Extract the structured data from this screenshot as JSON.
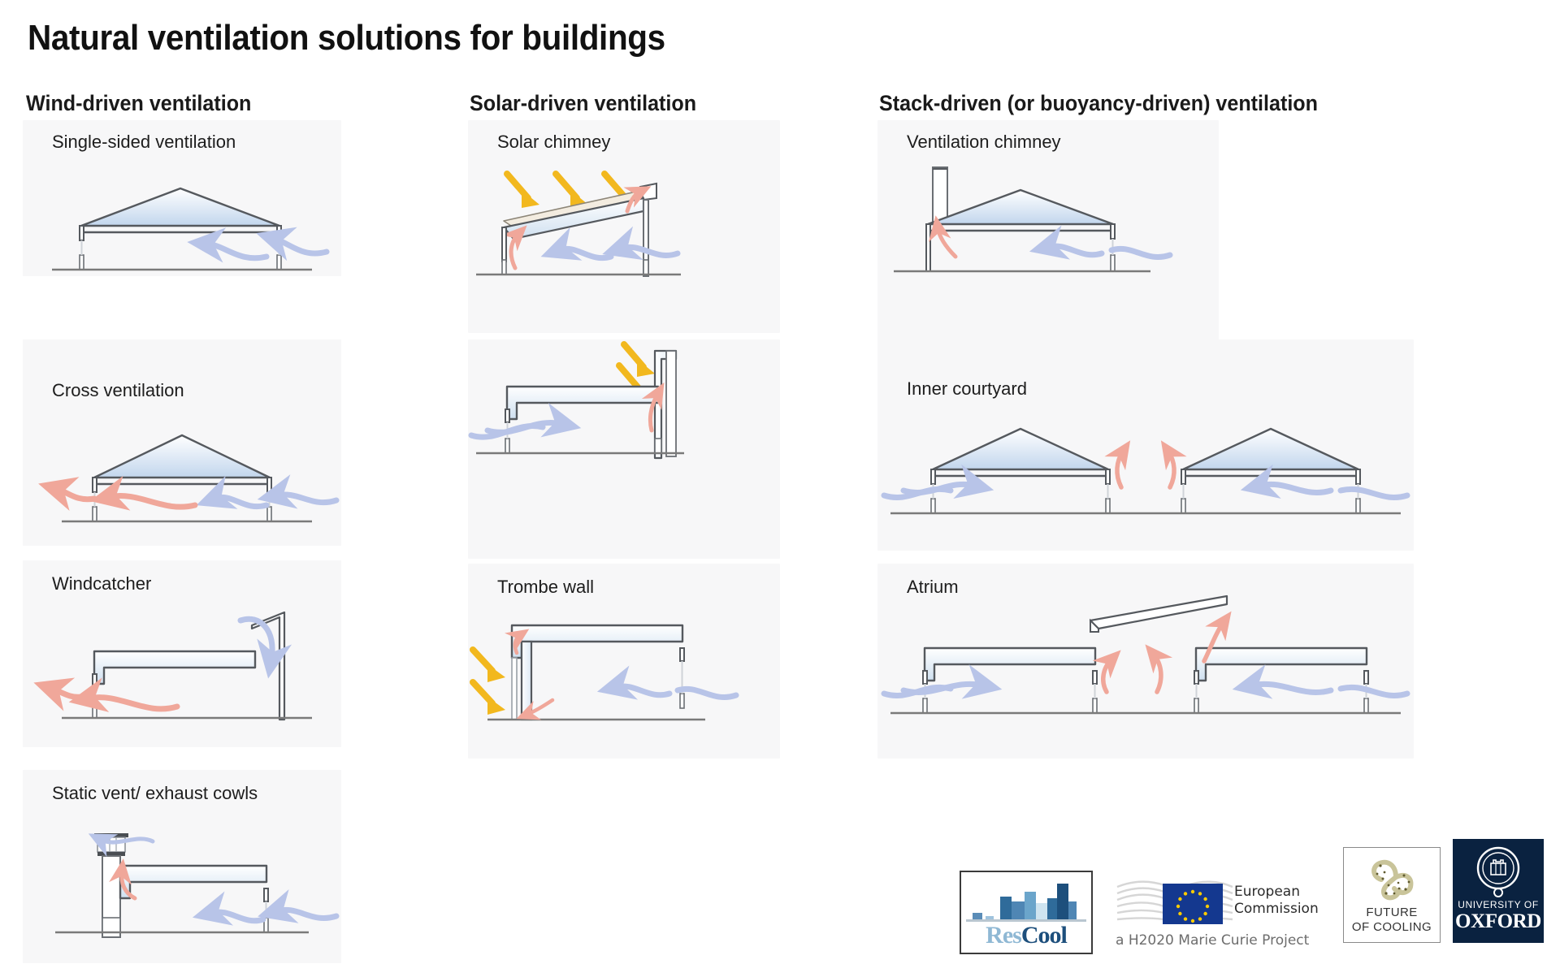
{
  "title": "Natural ventilation solutions for buildings",
  "columns": [
    {
      "id": "wind",
      "heading": "Wind-driven ventilation"
    },
    {
      "id": "solar",
      "heading": "Solar-driven ventilation"
    },
    {
      "id": "stack",
      "heading": "Stack-driven (or buoyancy-driven) ventilation"
    }
  ],
  "panels": {
    "single_sided": "Single-sided ventilation",
    "cross": "Cross ventilation",
    "windcatcher": "Windcatcher",
    "static_vent": "Static vent/ exhaust cowls",
    "solar_chimney": "Solar chimney",
    "solar_chimney2": "",
    "trombe": "Trombe wall",
    "vent_chimney": "Ventilation chimney",
    "courtyard": "Inner courtyard",
    "atrium": "Atrium"
  },
  "colors": {
    "cool_air_arrow": "#b8c4e8",
    "warm_air_arrow": "#f0a79a",
    "solar_arrow": "#f2b81e",
    "roof_fill_top": "#ffffff",
    "roof_fill_bottom": "#c4d8ee",
    "structure_stroke": "#55595e",
    "panel_background": "#f7f7f8",
    "ground_line": "#7a7a7a"
  },
  "logos": {
    "rescool": {
      "res": "Res",
      "cool": "Cool"
    },
    "european_commission": {
      "line1": "European",
      "line2": "Commission",
      "subtitle": "a H2020 Marie Curie Project"
    },
    "future_of_cooling": {
      "line1": "FUTURE",
      "line2": "OF COOLING"
    },
    "oxford": {
      "line1": "UNIVERSITY OF",
      "line2": "OXFORD"
    }
  }
}
